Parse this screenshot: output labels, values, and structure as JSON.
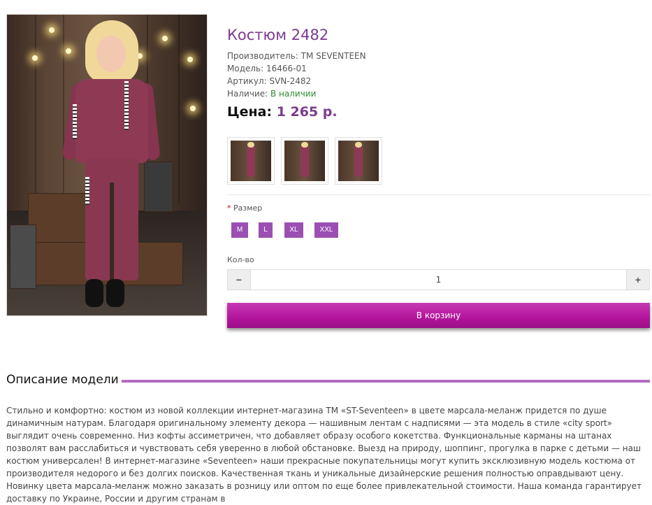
{
  "product": {
    "title": "Костюм 2482",
    "manufacturer_label": "Производитель:",
    "manufacturer": "TM SEVENTEEN",
    "model_label": "Модель:",
    "model": "16466-01",
    "sku_label": "Артикул:",
    "sku": "SVN-2482",
    "availability_label": "Наличие:",
    "availability": "В наличии",
    "price_label": "Цена:",
    "price": "1 265 р."
  },
  "gallery": {
    "thumbnails": [
      "thumbnail-1",
      "thumbnail-2",
      "thumbnail-3"
    ]
  },
  "options": {
    "required_mark": "*",
    "size_label": "Размер",
    "sizes": [
      "M",
      "L",
      "XL",
      "XXL"
    ],
    "qty_label": "Кол-во",
    "qty_value": "1",
    "minus": "−",
    "plus": "+",
    "cart_button": "В корзину"
  },
  "description": {
    "heading": "Описание модели",
    "text": "Стильно и комфортно: костюм из новой коллекции интернет-магазина ТМ «ST-Seventeen» в цвете марсала-меланж придется по душе динамичным натурам. Благодаря оригинальному элементу декора — нашивным лентам с надписями — эта модель в стиле «city sport» выглядит очень современно. Низ кофты ассиметричен, что добавляет образу особого кокетства. Функциональные карманы на штанах позволят вам расслабиться и чувствовать себя уверенно в любой обстановке. Выезд на природу, шоппинг, прогулка в парке с детьми — наш костюм универсален! В интернет-магазине «Seventeen» наши прекрасные покупательницы могут купить эксклюзивную модель костюма от производителя недорого и без долгих поисков. Качественная ткань и уникальные дизайнерские решения полностью оправдывают цену. Новинку цвета марсала-меланж можно заказать в розницу или оптом по еще более привлекательной стоимости. Наша команда гарантирует доставку по Украине, России и другим странам в"
  },
  "colors": {
    "accent": "#7b3a8e",
    "size_button": "#9b4fb3",
    "cart_button": "#b2149a",
    "in_stock": "#2e8b2e"
  }
}
